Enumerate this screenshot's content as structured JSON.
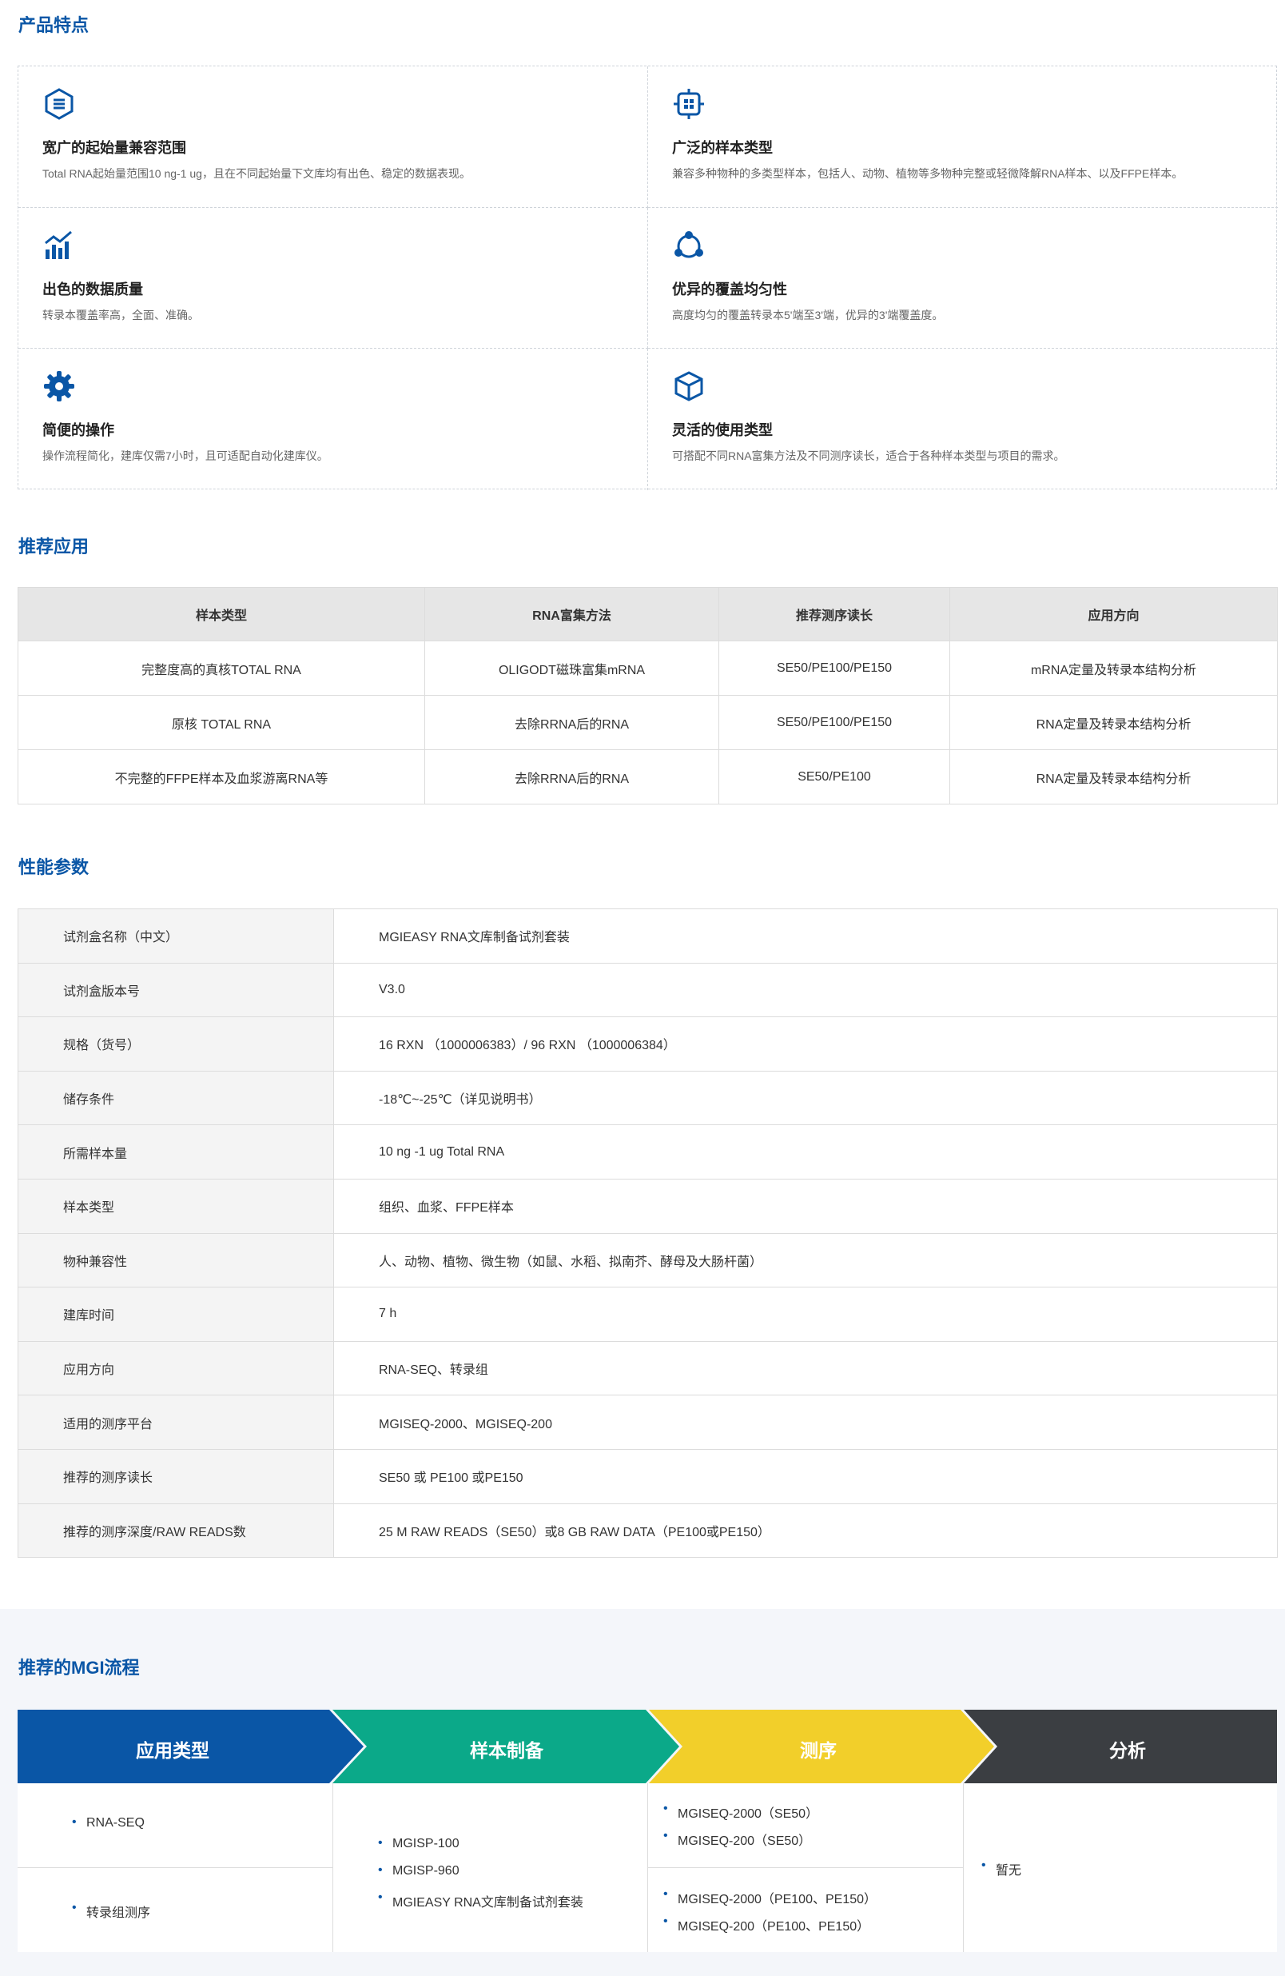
{
  "sections": {
    "features_title": "产品特点",
    "apps_title": "推荐应用",
    "perf_title": "性能参数",
    "workflow_title": "推荐的MGI流程"
  },
  "features": [
    {
      "icon": "s-logo-icon",
      "title": "宽广的起始量兼容范围",
      "desc": "Total RNA起始量范围10 ng-1 ug，且在不同起始量下文库均有出色、稳定的数据表现。"
    },
    {
      "icon": "grid-network-icon",
      "title": "广泛的样本类型",
      "desc": "兼容多种物种的多类型样本，包括人、动物、植物等多物种完整或轻微降解RNA样本、以及FFPE样本。"
    },
    {
      "icon": "bar-chart-icon",
      "title": "出色的数据质量",
      "desc": "转录本覆盖率高，全面、准确。"
    },
    {
      "icon": "cycle-nodes-icon",
      "title": "优异的覆盖均匀性",
      "desc": "高度均匀的覆盖转录本5'端至3'端，优异的3'端覆盖度。"
    },
    {
      "icon": "gear-icon",
      "title": "简便的操作",
      "desc": "操作流程简化，建库仅需7小时，且可适配自动化建库仪。"
    },
    {
      "icon": "cube-icon",
      "title": "灵活的使用类型",
      "desc": "可搭配不同RNA富集方法及不同测序读长，适合于各种样本类型与项目的需求。"
    }
  ],
  "app_table": {
    "headers": [
      "样本类型",
      "RNA富集方法",
      "推荐测序读长",
      "应用方向"
    ],
    "rows": [
      [
        "完整度高的真核TOTAL RNA",
        "OLIGODT磁珠富集mRNA",
        "SE50/PE100/PE150",
        "mRNA定量及转录本结构分析"
      ],
      [
        "原核 TOTAL RNA",
        "去除RRNA后的RNA",
        "SE50/PE100/PE150",
        "RNA定量及转录本结构分析"
      ],
      [
        "不完整的FFPE样本及血浆游离RNA等",
        "去除RRNA后的RNA",
        "SE50/PE100",
        "RNA定量及转录本结构分析"
      ]
    ]
  },
  "perf_table": [
    [
      "试剂盒名称（中文）",
      "MGIEASY RNA文库制备试剂套装"
    ],
    [
      "试剂盒版本号",
      "V3.0"
    ],
    [
      "规格（货号）",
      "16 RXN （1000006383）/ 96 RXN （1000006384）"
    ],
    [
      "储存条件",
      "-18℃~-25℃（详见说明书）"
    ],
    [
      "所需样本量",
      "10 ng -1 ug Total RNA"
    ],
    [
      "样本类型",
      "组织、血浆、FFPE样本"
    ],
    [
      "物种兼容性",
      "人、动物、植物、微生物（如鼠、水稻、拟南芥、酵母及大肠杆菌）"
    ],
    [
      "建库时间",
      "7 h"
    ],
    [
      "应用方向",
      "RNA-SEQ、转录组"
    ],
    [
      "适用的测序平台",
      "MGISEQ-2000、MGISEQ-200"
    ],
    [
      "推荐的测序读长",
      "SE50 或 PE100 或PE150"
    ],
    [
      "推荐的测序深度/RAW READS数",
      "25 M RAW READS（SE50）或8 GB RAW DATA（PE100或PE150）"
    ]
  ],
  "workflow": {
    "steps": [
      {
        "label": "应用类型",
        "color": "#0a56a6"
      },
      {
        "label": "样本制备",
        "color": "#0ba989"
      },
      {
        "label": "测序",
        "color": "#f2cf2a"
      },
      {
        "label": "分析",
        "color": "#3b3e42"
      }
    ],
    "app_types": [
      "RNA-SEQ",
      "转录组测序"
    ],
    "prep": [
      "MGISP-100",
      "MGISP-960",
      "MGIEASY RNA文库制备试剂套装"
    ],
    "seq_top": [
      "MGISEQ-2000（SE50）",
      "MGISEQ-200（SE50）"
    ],
    "seq_bottom": [
      "MGISEQ-2000（PE100、PE150）",
      "MGISEQ-200（PE100、PE150）"
    ],
    "analysis": [
      "暂无"
    ]
  }
}
